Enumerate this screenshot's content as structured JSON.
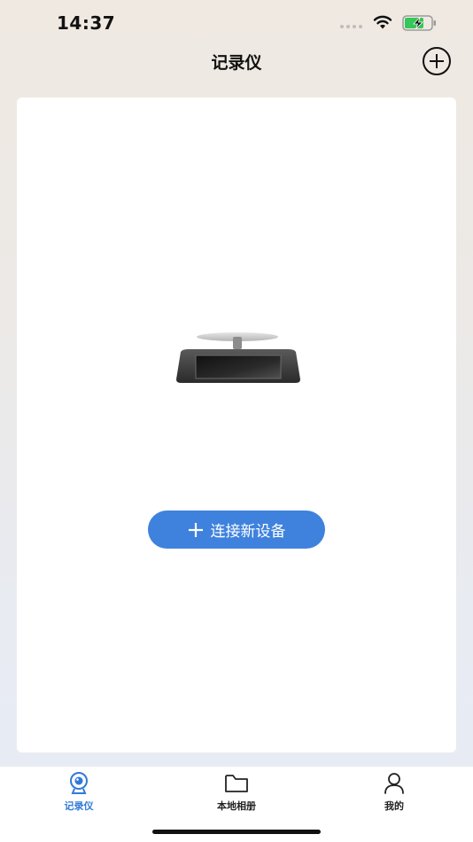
{
  "status_bar": {
    "time": "14:37",
    "battery_color": "#34c759"
  },
  "header": {
    "title": "记录仪",
    "add_icon": "plus-circle-icon"
  },
  "main": {
    "device_image": "dashcam-mirror",
    "connect_button_label": "连接新设备"
  },
  "tab_bar": {
    "active_color": "#2f7ad9",
    "tabs": [
      {
        "label": "记录仪",
        "icon": "dashcam-icon",
        "active": true
      },
      {
        "label": "本地相册",
        "icon": "folder-icon",
        "active": false
      },
      {
        "label": "我的",
        "icon": "person-icon",
        "active": false
      }
    ]
  }
}
